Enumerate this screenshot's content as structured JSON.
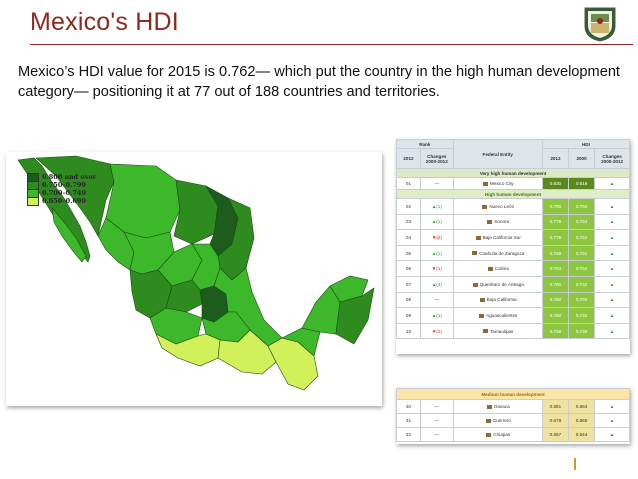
{
  "slide": {
    "title": "Mexico's HDI",
    "body": "Mexico’s HDI value for 2015 is 0.762— which put the country in the high human development category— positioning it at 77 out of 188 countries and territories."
  },
  "colors": {
    "title": "#8b2a1e",
    "band_0800": "#1d5c1d",
    "band_0750": "#2e8b1e",
    "band_0700": "#3db82a",
    "band_0650": "#d2f05a"
  },
  "legend": [
    {
      "label": "0.800 and over",
      "color": "#1d5c1d"
    },
    {
      "label": "0.750–0.799",
      "color": "#2e8b1e"
    },
    {
      "label": "0.700–0.749",
      "color": "#3db82a"
    },
    {
      "label": "0.650–0.699",
      "color": "#d2f05a"
    }
  ],
  "table": {
    "head_rank": "Rank",
    "head_hdi": "HDI",
    "head_2012": "2012",
    "head_changes": "Changes 2000-2012",
    "head_entity": "Federal Entity",
    "head_hdi2012": "2012",
    "head_hdi2000": "2000",
    "head_hdi_changes": "Changes 2000-2012",
    "cat_very_high": "Very high human development",
    "cat_high": "High human development",
    "cat_medium": "Medium human development",
    "rows_top": [
      {
        "rank": "01",
        "change": "—",
        "dir": "none",
        "entity": "Mexico City",
        "v2012": "0.830",
        "v2000": "0.818",
        "band": "v1"
      },
      {
        "rank": "02",
        "change": "▲(1)",
        "dir": "up",
        "entity": "Nuevo León",
        "v2012": "0.790",
        "v2000": "0.763",
        "band": "v2"
      },
      {
        "rank": "03",
        "change": "▲(1)",
        "dir": "up",
        "entity": "Sonora",
        "v2012": "0.779",
        "v2000": "0.764",
        "band": "v2"
      },
      {
        "rank": "04",
        "change": "▼(2)",
        "dir": "dn",
        "entity": "Baja California Sur",
        "v2012": "0.776",
        "v2000": "0.752",
        "band": "v2"
      },
      {
        "rank": "05",
        "change": "▲(1)",
        "dir": "up",
        "entity": "Coahuila de Zaragoza",
        "v2012": "0.768",
        "v2000": "0.751",
        "band": "v2"
      },
      {
        "rank": "06",
        "change": "▼(1)",
        "dir": "dn",
        "entity": "Colima",
        "v2012": "0.763",
        "v2000": "0.754",
        "band": "v2"
      },
      {
        "rank": "07",
        "change": "▲(4)",
        "dir": "up",
        "entity": "Querétaro de Arteaga",
        "v2012": "0.760",
        "v2000": "0.742",
        "band": "v2"
      },
      {
        "rank": "08",
        "change": "—",
        "dir": "none",
        "entity": "Baja California",
        "v2012": "0.760",
        "v2000": "0.750",
        "band": "v2"
      },
      {
        "rank": "09",
        "change": "▲(1)",
        "dir": "up",
        "entity": "Aguascalientes",
        "v2012": "0.760",
        "v2000": "0.742",
        "band": "v2"
      },
      {
        "rank": "10",
        "change": "▼(1)",
        "dir": "dn",
        "entity": "Tamaulipas",
        "v2012": "0.758",
        "v2000": "0.749",
        "band": "v2"
      }
    ],
    "rows_bottom": [
      {
        "rank": "30",
        "change": "—",
        "dir": "none",
        "entity": "Oaxaca",
        "v2012": "0.681",
        "v2000": "0.664"
      },
      {
        "rank": "31",
        "change": "—",
        "dir": "none",
        "entity": "Guerrero",
        "v2012": "0.679",
        "v2000": "0.665"
      },
      {
        "rank": "32",
        "change": "—",
        "dir": "none",
        "entity": "Chiapas",
        "v2012": "0.667",
        "v2000": "0.644"
      }
    ]
  }
}
